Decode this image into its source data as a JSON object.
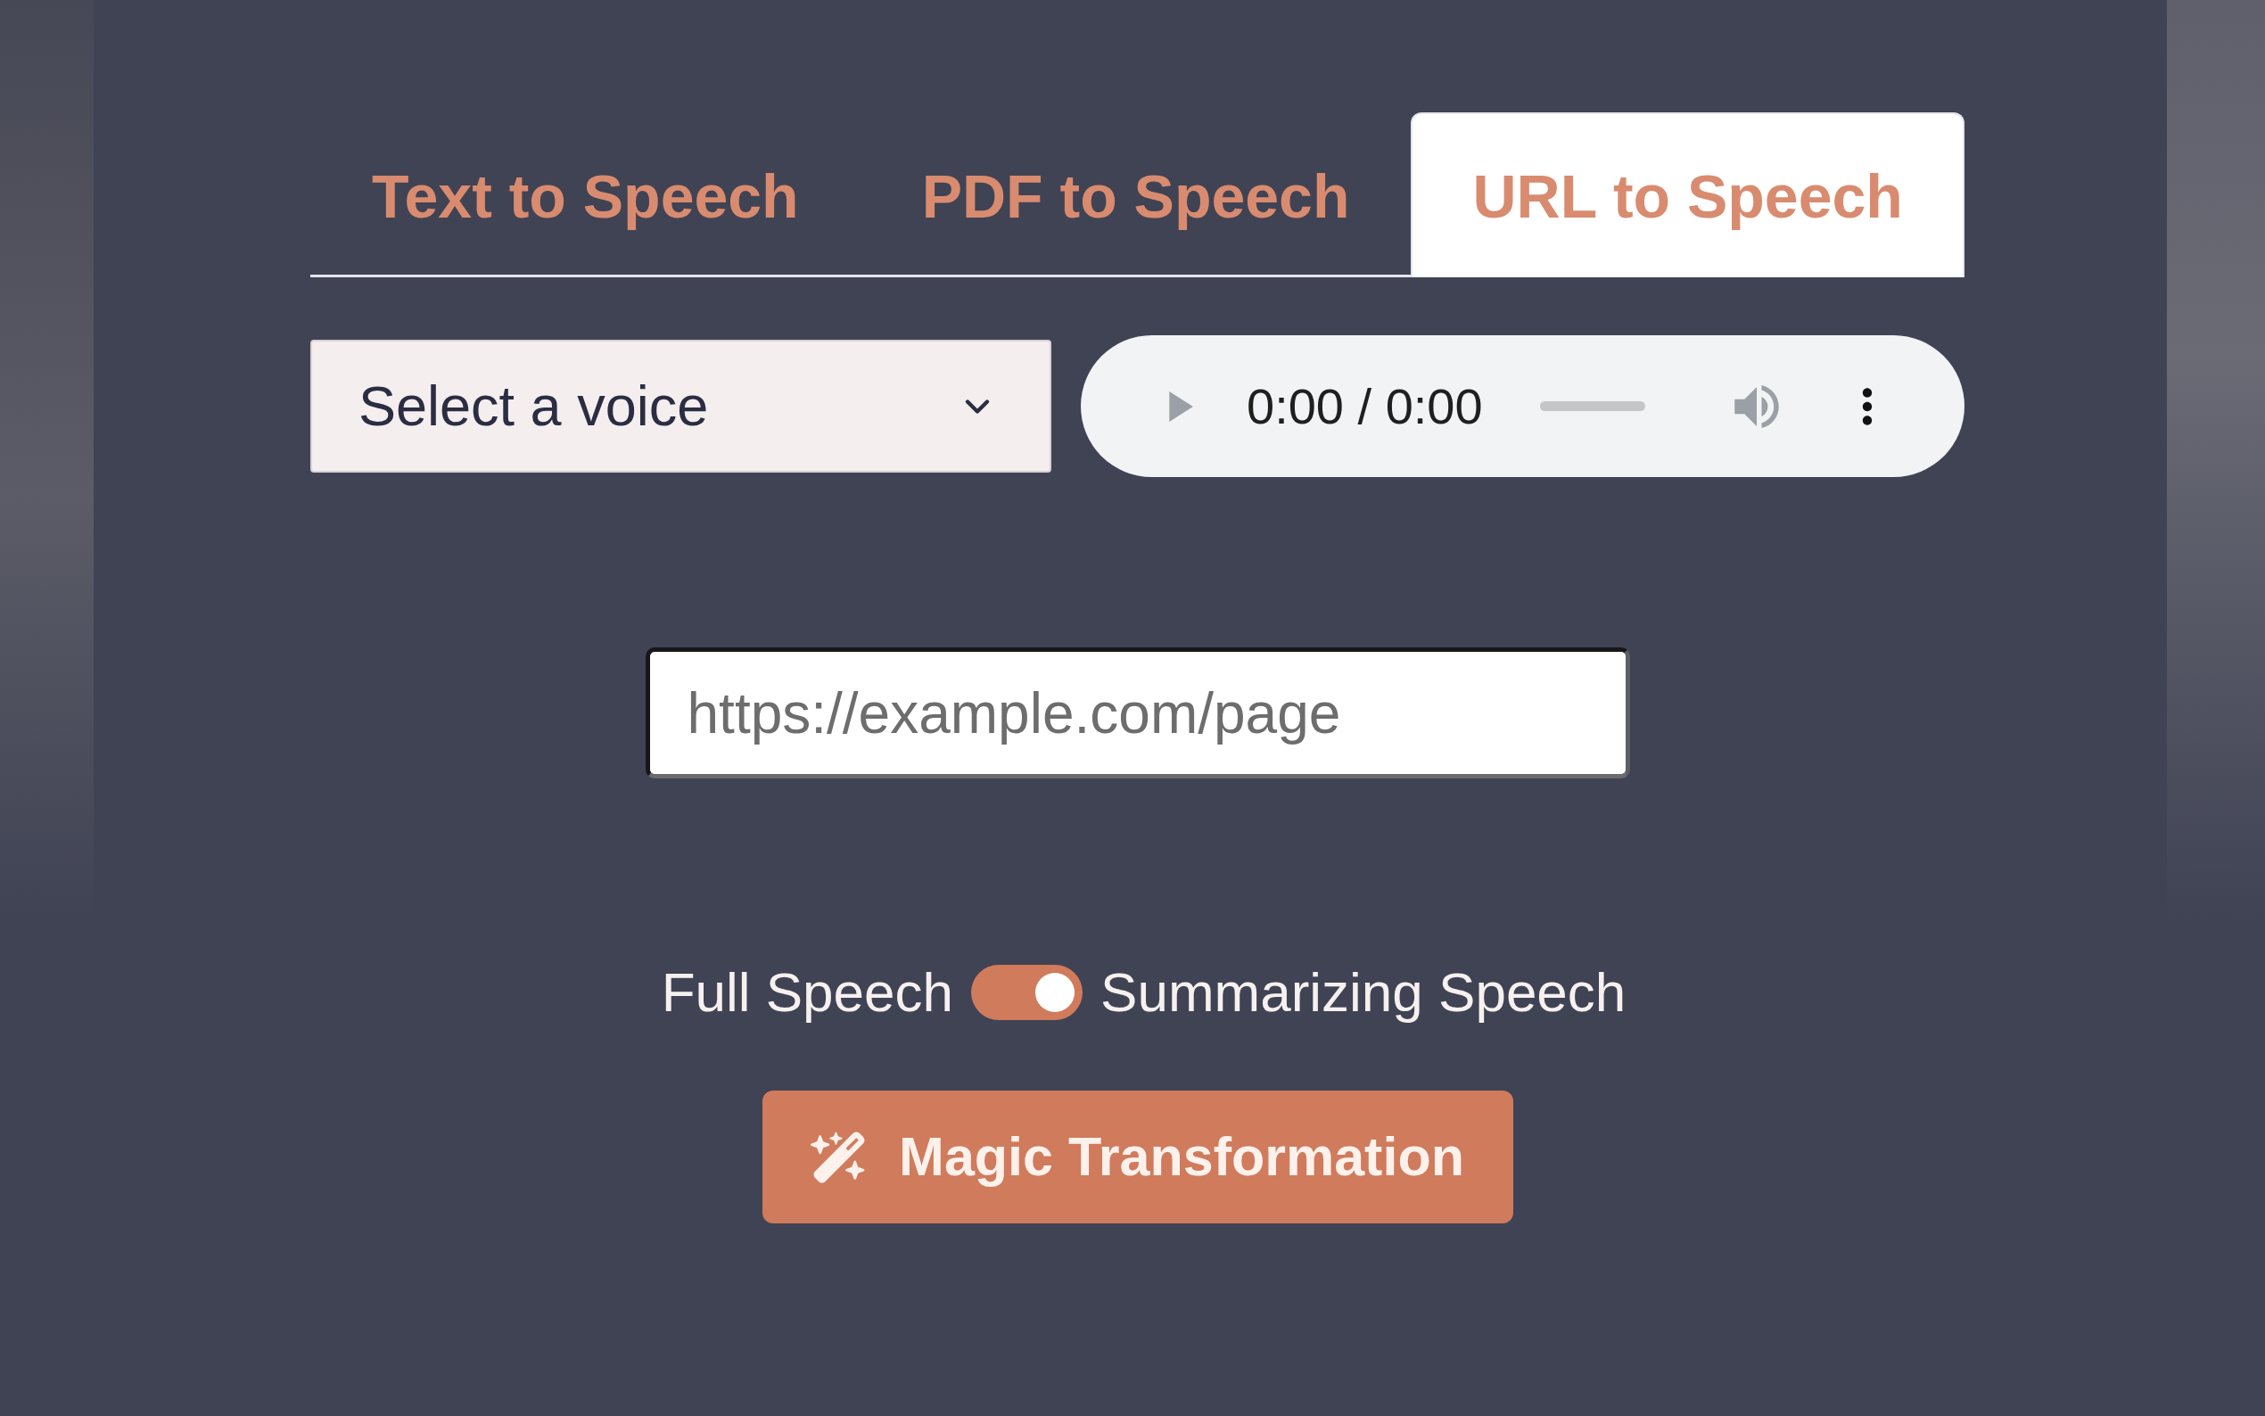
{
  "tabs": [
    {
      "label": "Text to Speech",
      "selected": false
    },
    {
      "label": "PDF to Speech",
      "selected": false
    },
    {
      "label": "URL to Speech",
      "selected": true
    }
  ],
  "voice_select": {
    "value": "Select a voice"
  },
  "audio_player": {
    "time": "0:00 / 0:00"
  },
  "url_input": {
    "placeholder": "https://example.com/page"
  },
  "speech_mode": {
    "left_label": "Full Speech",
    "on": true,
    "right_label": "Summarizing Speech"
  },
  "action_button": {
    "label": "Magic Transformation"
  }
}
